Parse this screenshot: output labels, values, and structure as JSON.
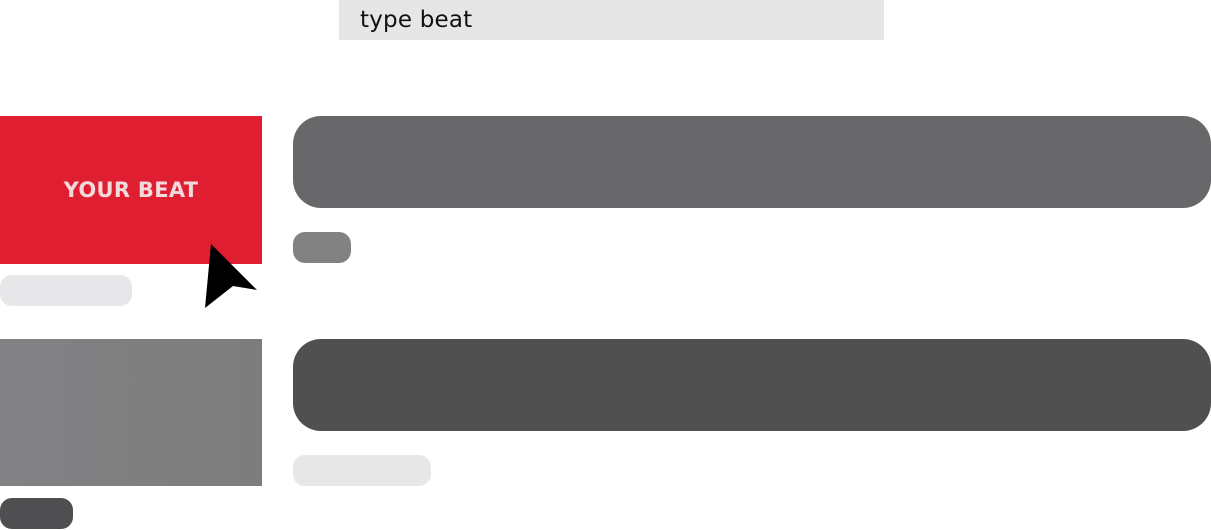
{
  "search": {
    "query": "type beat"
  },
  "results": [
    {
      "thumbnail_label": "YOUR BEAT",
      "thumbnail_color": "#df1f31"
    },
    {
      "thumbnail_label": "",
      "thumbnail_color": "#808080"
    }
  ],
  "icons": {
    "pointer": "mouse-pointer-icon"
  }
}
